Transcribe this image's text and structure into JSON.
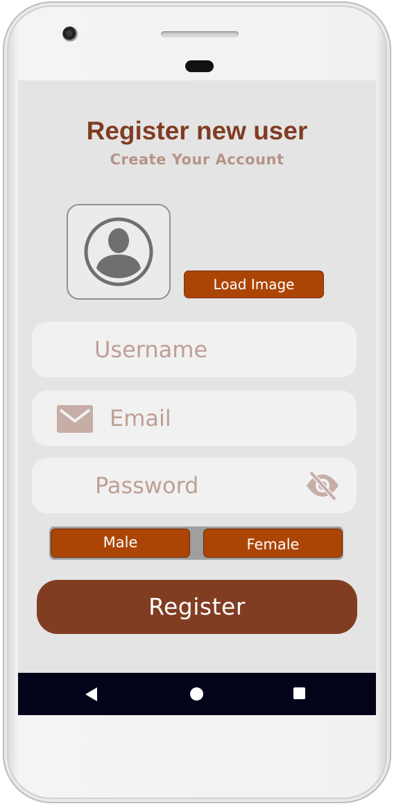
{
  "header": {
    "title": "Register new user",
    "subtitle": "Create Your Account"
  },
  "avatar": {
    "icon": "account-circle-icon",
    "load_button_label": "Load Image"
  },
  "form": {
    "username_placeholder": "Username",
    "email_placeholder": "Email",
    "email_icon": "mail-icon",
    "password_placeholder": "Password",
    "password_toggle_icon": "eye-off-icon"
  },
  "gender": {
    "options": [
      "Male",
      "Female"
    ]
  },
  "register_button_label": "Register",
  "navigation_bar": {
    "back_icon": "back-triangle-icon",
    "home_icon": "home-circle-icon",
    "recents_icon": "recents-square-icon"
  },
  "colors": {
    "accent": "#803c22",
    "button_orange": "#ab4506",
    "placeholder": "#bd9f94",
    "screen_background": "#e5e4e4",
    "nav_bar": "#03031a"
  }
}
